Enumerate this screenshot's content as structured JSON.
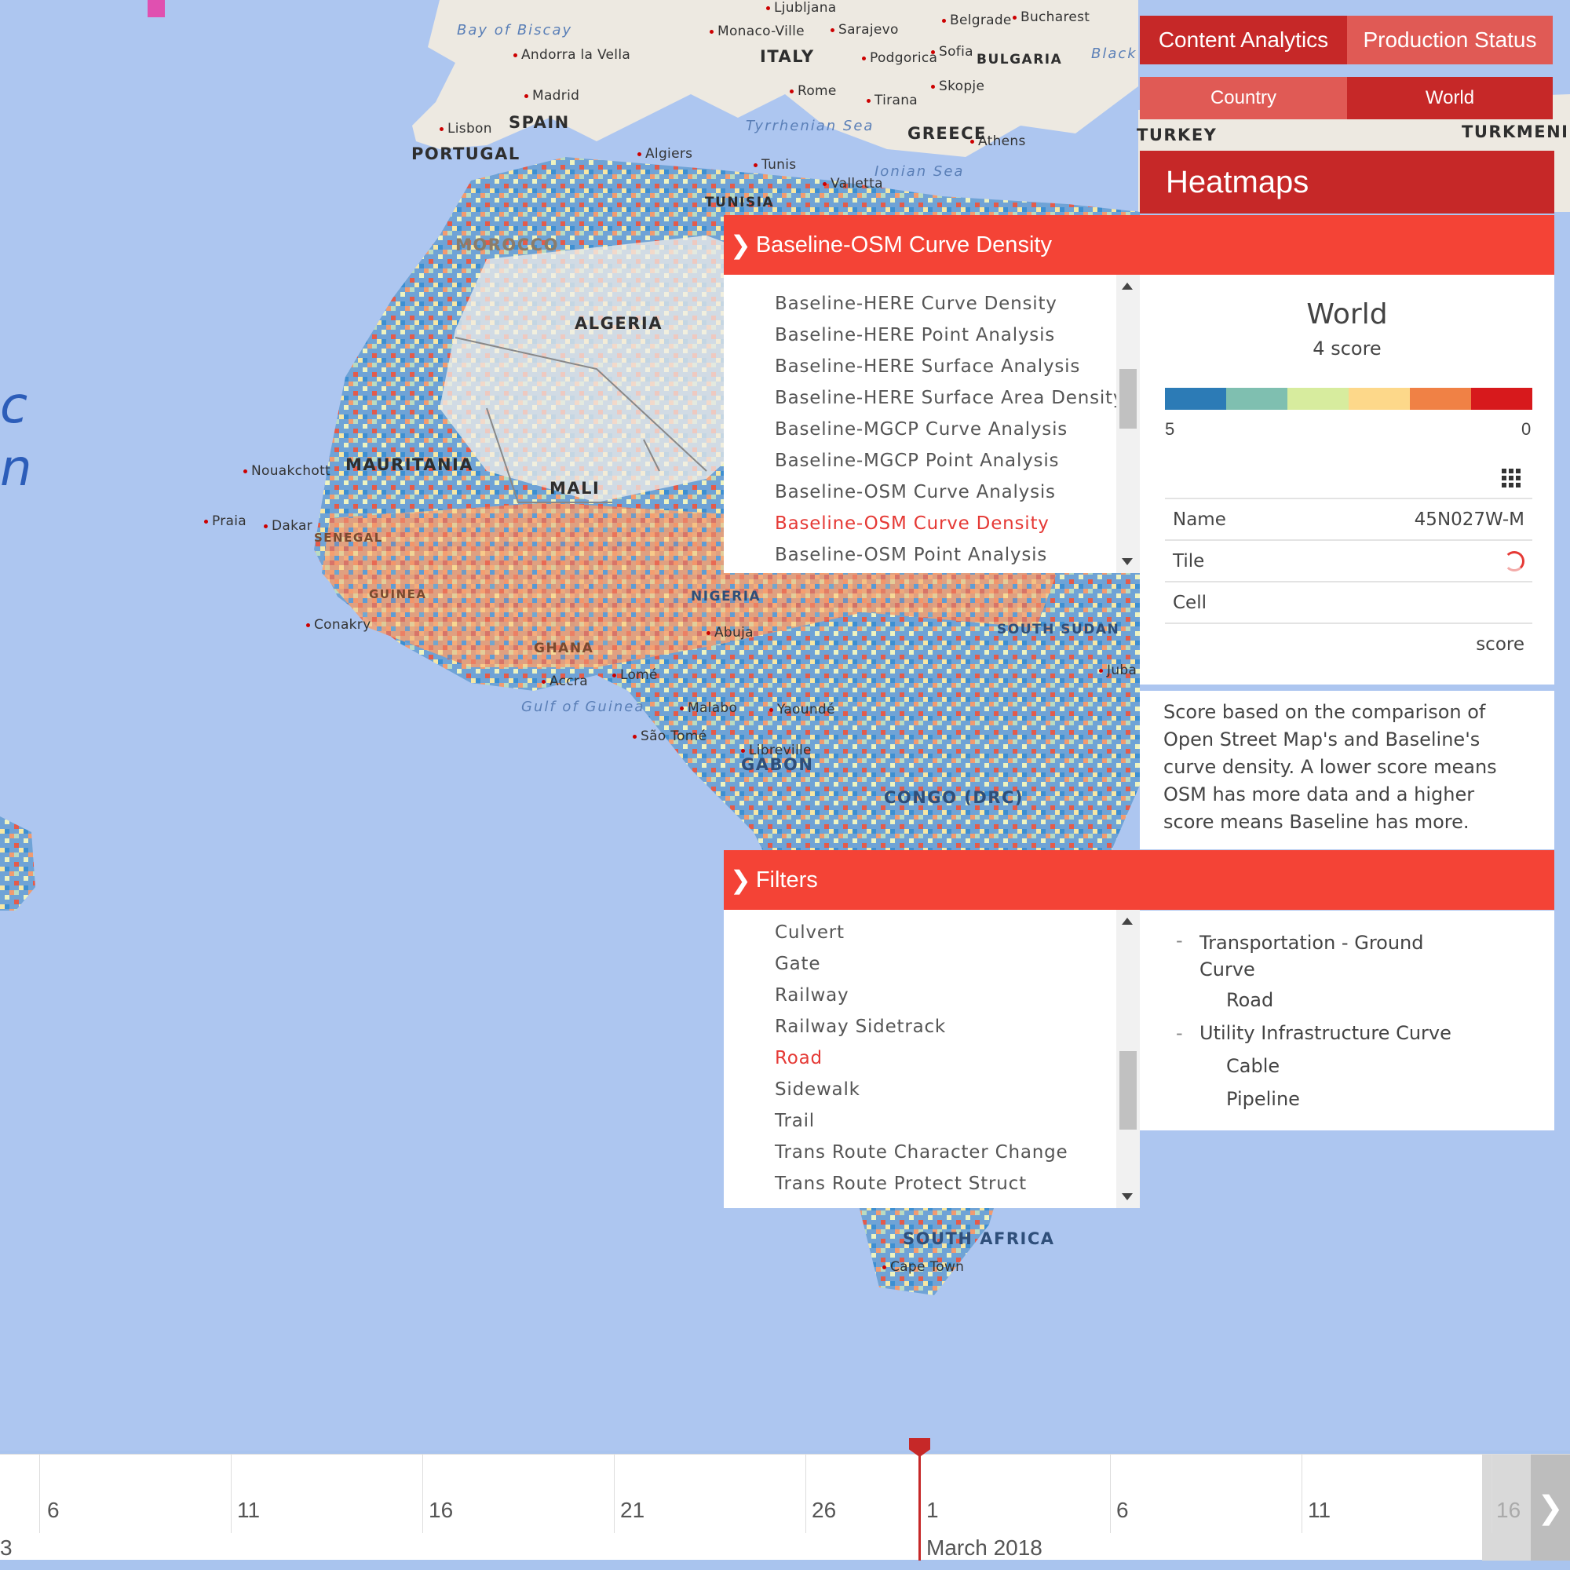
{
  "colors": {
    "primary": "#d32f2f",
    "accent": "#f44336",
    "active_item": "#e53935",
    "legend": [
      "#2c7bb6",
      "#7fbfb0",
      "#d7ec9e",
      "#fdd88a",
      "#f08145",
      "#d7191c"
    ]
  },
  "nav": {
    "tabs": [
      "Content Analytics",
      "Production Status"
    ],
    "scope_tabs": [
      "Country",
      "World"
    ]
  },
  "heatmaps": {
    "title": "Heatmaps",
    "selected": "Baseline-OSM Curve Density",
    "options": [
      "Baseline-HERE Curve Density",
      "Baseline-HERE Point Analysis",
      "Baseline-HERE Surface Analysis",
      "Baseline-HERE Surface Area Density",
      "Baseline-MGCP Curve Analysis",
      "Baseline-MGCP Point Analysis",
      "Baseline-OSM Curve Analysis",
      "Baseline-OSM Curve Density",
      "Baseline-OSM Point Analysis"
    ]
  },
  "legend": {
    "title": "World",
    "subtitle": "4 score",
    "max_label": "5",
    "min_label": "0",
    "grid_icon": "grid-icon"
  },
  "info": {
    "rows": [
      {
        "label": "Name",
        "value": "45N027W-M"
      },
      {
        "label": "Tile",
        "value": ""
      },
      {
        "label": "Cell",
        "value": ""
      }
    ],
    "unit": "score",
    "description": "Score based on the comparison of Open Street Map's and Baseline's curve density. A lower score means OSM has more data and a higher score means Baseline has more."
  },
  "filters": {
    "title": "Filters",
    "selected": "Road",
    "options": [
      "Culvert",
      "Gate",
      "Railway",
      "Railway Sidetrack",
      "Road",
      "Sidewalk",
      "Trail",
      "Trans Route Character Change",
      "Trans Route Protect Struct"
    ],
    "tree": [
      {
        "group": "Transportation - Ground Curve",
        "children": [
          "Road"
        ]
      },
      {
        "group": "Utility Infrastructure Curve",
        "children": [
          "Cable",
          "Pipeline"
        ]
      }
    ]
  },
  "timeline": {
    "ticks": [
      "6",
      "11",
      "16",
      "21",
      "26",
      "1",
      "6",
      "11",
      "16"
    ],
    "month": "March 2018",
    "prev_fragment": "3",
    "next_icon": "chevron-right-icon"
  },
  "map": {
    "labels": {
      "countries": [
        "ALGERIA",
        "MAURITANIA",
        "MALI",
        "SPAIN",
        "PORTUGAL",
        "ITALY",
        "GREECE",
        "TURKEY",
        "BULGARIA",
        "MOROCCO",
        "TUNISIA",
        "SOUTH AFRICA",
        "GABON",
        "CONGO (DRC)",
        "SOUTH SUDAN",
        "NIGERIA",
        "GHANA",
        "SENEGAL",
        "GUINEA",
        "TURKMENIST"
      ],
      "cities": [
        "Madrid",
        "Lisbon",
        "Rome",
        "Athens",
        "Algiers",
        "Nouakchott",
        "Dakar",
        "Praia",
        "Conakry",
        "Accra",
        "Lomé",
        "Malabo",
        "São Tomé",
        "Tunis",
        "Valletta",
        "Belgrade",
        "Bucharest",
        "Sarajevo",
        "Tirana",
        "Skopje",
        "Sofia",
        "Podgorica",
        "Andorra la Vella",
        "Monaco-Ville",
        "Ljubljana",
        "Cape Town",
        "Abuja",
        "Juba",
        "Yaoundé",
        "Libreville"
      ],
      "seas": [
        "Bay of Biscay",
        "Tyrrhenian Sea",
        "Ionian Sea",
        "Gulf of Guinea",
        "Black"
      ],
      "ocean_fragment": [
        "c",
        "n"
      ]
    }
  }
}
